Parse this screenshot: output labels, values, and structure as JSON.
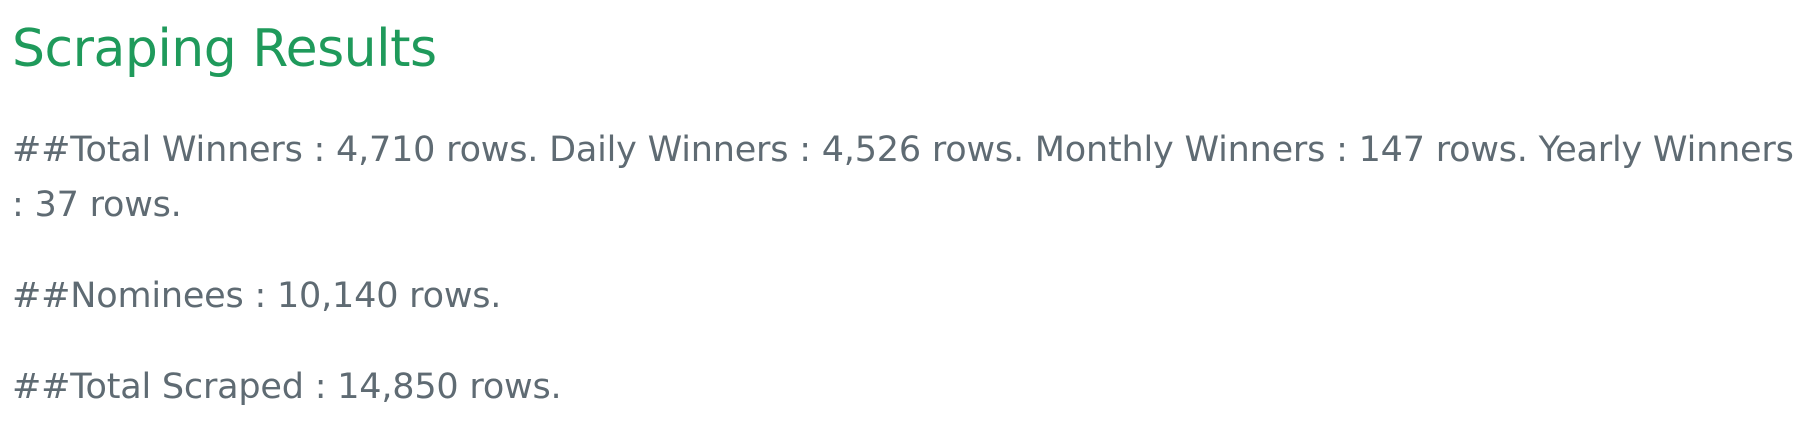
{
  "page": {
    "title": "Scraping Results"
  },
  "results": {
    "winners_text": "##Total Winners : 4,710 rows. Daily Winners : 4,526 rows. Monthly Winners : 147 rows. Yearly Winners : 37 rows.",
    "nominees_text": "##Nominees : 10,140 rows.",
    "total_scraped_text": "##Total Scraped : 14,850 rows."
  },
  "colors": {
    "title": "#1f9a5b",
    "text": "#5f6b73",
    "background": "#ffffff"
  }
}
